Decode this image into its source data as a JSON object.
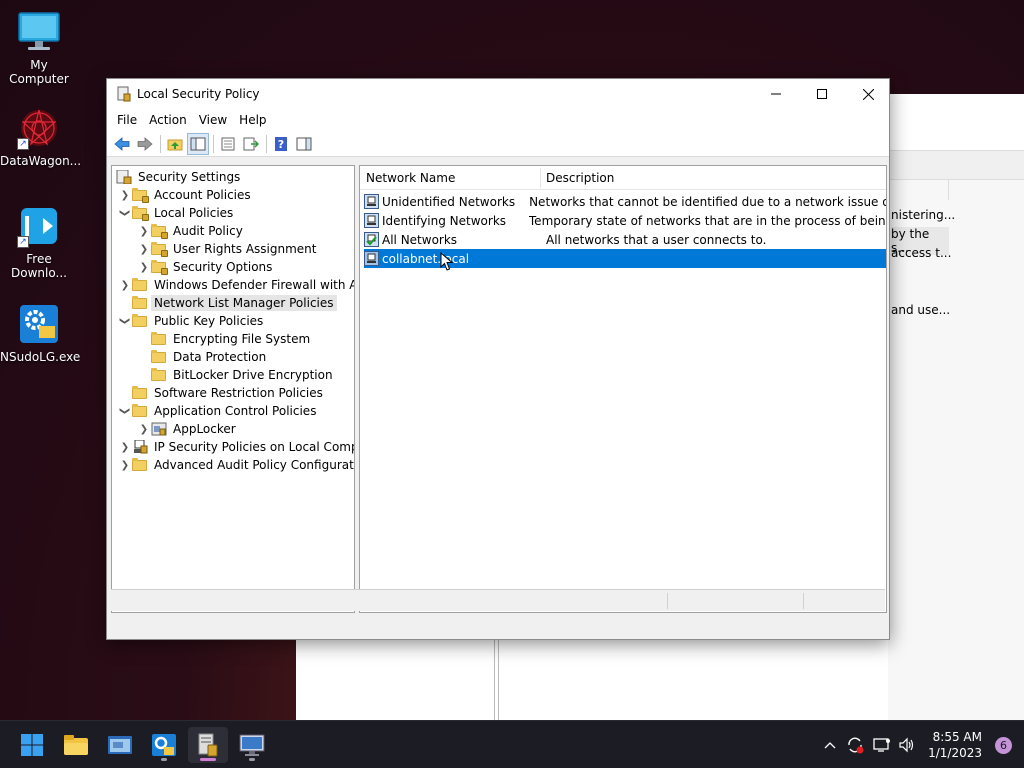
{
  "desktop": {
    "icons": [
      {
        "label": "My Computer"
      },
      {
        "label": "DataWagon..."
      },
      {
        "label": "Free Downlo..."
      },
      {
        "label": "NSudoLG.exe"
      }
    ]
  },
  "background_window": {
    "snippets": [
      "nistering...",
      "by the s...",
      "access t...",
      "and use..."
    ]
  },
  "window": {
    "title": "Local Security Policy",
    "menu": [
      "File",
      "Action",
      "View",
      "Help"
    ]
  },
  "tree": {
    "items": [
      {
        "label": "Security Settings"
      },
      {
        "label": "Account Policies"
      },
      {
        "label": "Local Policies"
      },
      {
        "label": "Audit Policy"
      },
      {
        "label": "User Rights Assignment"
      },
      {
        "label": "Security Options"
      },
      {
        "label": "Windows Defender Firewall with Adva"
      },
      {
        "label": "Network List Manager Policies"
      },
      {
        "label": "Public Key Policies"
      },
      {
        "label": "Encrypting File System"
      },
      {
        "label": "Data Protection"
      },
      {
        "label": "BitLocker Drive Encryption"
      },
      {
        "label": "Software Restriction Policies"
      },
      {
        "label": "Application Control Policies"
      },
      {
        "label": "AppLocker"
      },
      {
        "label": "IP Security Policies on Local Compute"
      },
      {
        "label": "Advanced Audit Policy Configuration"
      }
    ]
  },
  "list": {
    "columns": [
      "Network Name",
      "Description"
    ],
    "rows": [
      {
        "name": "Unidentified Networks",
        "desc": "Networks that cannot be identified due to a network issue or lack"
      },
      {
        "name": "Identifying Networks",
        "desc": "Temporary state of networks that are in the process of being iden"
      },
      {
        "name": "All Networks",
        "desc": "All networks that a user connects to."
      },
      {
        "name": "collabnet.local",
        "desc": ""
      }
    ]
  },
  "taskbar": {
    "time": "8:55 AM",
    "date": "1/1/2023",
    "notification_count": "6"
  },
  "colors": {
    "accent": "#0078d7",
    "taskbar": "#1c1c24"
  }
}
